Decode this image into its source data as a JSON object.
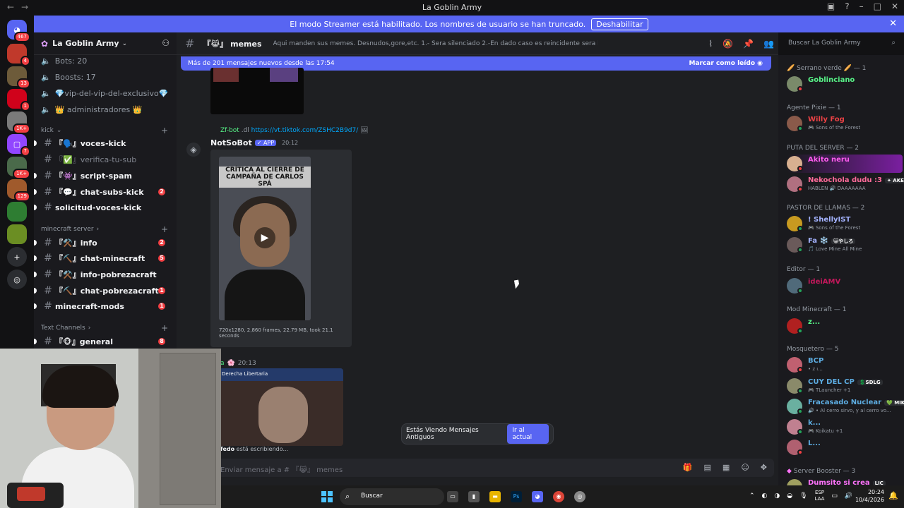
{
  "window": {
    "title": "La Goblin Army"
  },
  "streamer": {
    "message": "El modo Streamer está habilitado. Los nombres de usuario se han truncado.",
    "button": "Deshabilitar"
  },
  "guilds": [
    {
      "badge": "467"
    },
    {
      "badge": "4"
    },
    {
      "badge": "13"
    },
    {
      "badge": "1"
    },
    {
      "badge": "1K+"
    },
    {
      "badge": "7"
    },
    {
      "badge": "1K+"
    },
    {
      "badge": "129"
    },
    {
      "badge": ""
    },
    {
      "badge": ""
    }
  ],
  "server": {
    "name": "La Goblin Army"
  },
  "sidebar": {
    "info_rows": [
      {
        "label": "Bots: 20"
      },
      {
        "label": "Boosts: 17"
      },
      {
        "label": "💎vip-del-vip-del-exclusivo💎"
      },
      {
        "label": "👑 administradores 👑"
      }
    ],
    "categories": [
      {
        "label": "kick"
      },
      {
        "label": "minecraft server"
      },
      {
        "label": "Text Channels"
      }
    ],
    "channels": [
      {
        "prefix": "『🗣️』",
        "label": "voces-kick",
        "badge": ""
      },
      {
        "prefix": "『✅』",
        "label": "verifica-tu-sub",
        "badge": ""
      },
      {
        "prefix": "『👾』",
        "label": "script-spam",
        "badge": ""
      },
      {
        "prefix": "『💬』",
        "label": "chat-subs-kick",
        "badge": "2"
      },
      {
        "prefix": "",
        "label": "solicitud-voces-kick",
        "badge": ""
      },
      {
        "prefix": "『⚒️』",
        "label": "info",
        "badge": "2"
      },
      {
        "prefix": "『⛏️』",
        "label": "chat-minecraft",
        "badge": "5"
      },
      {
        "prefix": "『⚒️』",
        "label": "info-pobrezacraft",
        "badge": ""
      },
      {
        "prefix": "『⛏️』",
        "label": "chat-pobrezacraft",
        "badge": "1"
      },
      {
        "prefix": "",
        "label": "minecraft-mods",
        "badge": "1"
      },
      {
        "prefix": "『🐵』",
        "label": "general",
        "badge": "8"
      }
    ]
  },
  "channel": {
    "prefix": "『😹』",
    "name": "memes",
    "topic": "Aqui manden sus memes. Desnudos,gore,etc. 1.- Sera silenciado 2.-En dado caso es reincidente sera baneado"
  },
  "search": {
    "placeholder": "Buscar La Goblin Army"
  },
  "newbar": {
    "text": "Más de 201 mensajes nuevos desde las 17:54",
    "mark": "Marcar como leído"
  },
  "message": {
    "reply_user": "Zf-bot",
    "reply_cmd": ".dl",
    "reply_link": "https://vt.tiktok.com/ZSHC2B9d7/",
    "author": "NotSoBot",
    "app_tag": "✓ APP",
    "time": "20:12",
    "video_caption": "CRÍTICA AL CIERRE DE CAMPAÑA DE CARLOS SPÁ",
    "video_meta": "720x1280, 2,860 frames, 22.79 MB, took 21.1 seconds"
  },
  "message2": {
    "name": "a",
    "time": "20:13",
    "video_bar": "Derecha Libertaria"
  },
  "typing": {
    "user": "fedo",
    "text": " está escribiendo..."
  },
  "old_messages": {
    "text": "Estás Viendo Mensajes Antiguos",
    "button": "Ir al actual"
  },
  "composer": {
    "placeholder": "Enviar mensaje a # 『😹』 memes"
  },
  "members": {
    "groups": [
      {
        "label": "🥖 Serrano verde 🥖 — 1"
      },
      {
        "label": "Agente Pixie — 1"
      },
      {
        "label": "PUTA DEL SERVER — 2"
      },
      {
        "label": "PASTOR DE LLAMAS — 2"
      },
      {
        "label": "Editor — 1"
      },
      {
        "label": "Mod Minecraft — 1"
      },
      {
        "label": "Mosquetero — 5"
      },
      {
        "label": "Server Booster — 3"
      }
    ],
    "list": [
      {
        "name": "Goblinciano",
        "activity": "",
        "color": "#57f287",
        "tag": ""
      },
      {
        "name": "Willy Fog",
        "activity": "🎮 Sons of the Forest",
        "color": "#ed4245",
        "tag": ""
      },
      {
        "name": "Akito neru",
        "activity": "",
        "color": "#ff5cf0",
        "tag": ""
      },
      {
        "name": "Nekochola dudu :3",
        "activity": "HABLEN 🔊 DAAAAAAA",
        "color": "#ff6b9a",
        "tag": "✦ AKEF"
      },
      {
        "name": "! ShellyIST",
        "activity": "🎮 Sons of the Forest",
        "color": "#a4b3ff",
        "tag": ""
      },
      {
        "name": "Fa ❄️",
        "activity": "🎵 Love Mine All Mine",
        "color": "#a4b3ff",
        "tag": "😺やしろ"
      },
      {
        "name": "ideiAMV",
        "activity": "",
        "color": "#c2185b",
        "tag": ""
      },
      {
        "name": "z...",
        "activity": "",
        "color": "#57f287",
        "tag": ""
      },
      {
        "name": "BCP",
        "activity": "• z ı...",
        "color": "#5dade2",
        "tag": ""
      },
      {
        "name": "CUY DEL CP",
        "activity": "🎮 TLauncher +1",
        "color": "#5dade2",
        "tag": "💲SDLG"
      },
      {
        "name": "Fracasado Nuclear",
        "activity": "🔊 • Al cerro sirvo, y al cerro vo...",
        "color": "#5dade2",
        "tag": "💚 MIKU"
      },
      {
        "name": "k...",
        "activity": "🎮 Koikatu +1",
        "color": "#5dade2",
        "tag": ""
      },
      {
        "name": "L...",
        "activity": "",
        "color": "#5dade2",
        "tag": ""
      },
      {
        "name": "Dumsito si crea",
        "activity": "",
        "color": "#ff73fa",
        "tag": "LIC"
      }
    ]
  },
  "taskbar": {
    "search": "Buscar",
    "lang1": "ESP",
    "lang2": "LAA",
    "time": "20:24",
    "date": "10/4/2026"
  }
}
